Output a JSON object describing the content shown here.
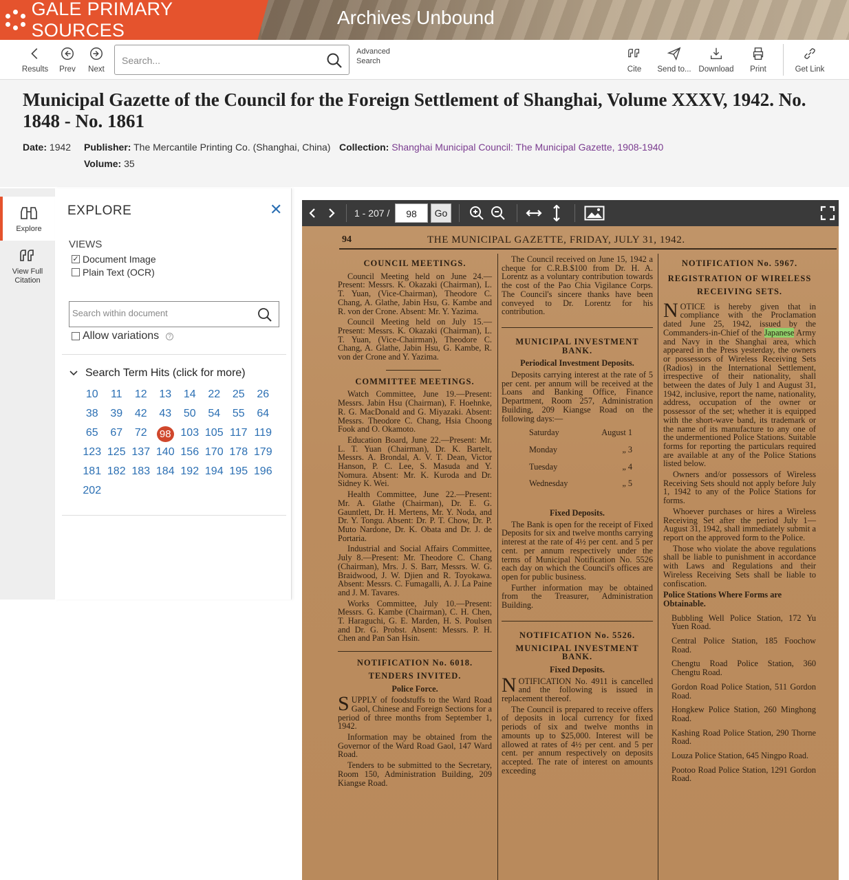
{
  "banner": {
    "brand": "GALE PRIMARY SOURCES",
    "product": "Archives Unbound"
  },
  "toolbar": {
    "results": "Results",
    "prev": "Prev",
    "next": "Next",
    "search_placeholder": "Search...",
    "advanced_search": "Advanced Search",
    "cite": "Cite",
    "send_to": "Send to...",
    "download": "Download",
    "print": "Print",
    "get_link": "Get Link"
  },
  "document": {
    "title": "Municipal Gazette of the Council for the Foreign Settlement of Shanghai, Volume XXXV, 1942. No. 1848 - No. 1861",
    "date_label": "Date:",
    "date": "1942",
    "publisher_label": "Publisher:",
    "publisher": "The Mercantile Printing Co. (Shanghai, China)",
    "collection_label": "Collection:",
    "collection": "Shanghai Municipal Council: The Municipal Gazette, 1908-1940",
    "volume_label": "Volume:",
    "volume": "35"
  },
  "rail": {
    "explore": "Explore",
    "view_full_citation": "View Full Citation"
  },
  "explore": {
    "title": "EXPLORE",
    "views_label": "VIEWS",
    "views": [
      {
        "label": "Document Image",
        "checked": true
      },
      {
        "label": "Plain Text (OCR)",
        "checked": false
      }
    ],
    "search_placeholder": "Search within document",
    "allow_variations": "Allow variations",
    "hits_header": "Search Term Hits (click for more)",
    "hits": [
      "10",
      "11",
      "12",
      "13",
      "14",
      "22",
      "25",
      "26",
      "38",
      "39",
      "42",
      "43",
      "50",
      "54",
      "55",
      "64",
      "65",
      "67",
      "72",
      "98",
      "103",
      "105",
      "117",
      "119",
      "123",
      "125",
      "137",
      "140",
      "156",
      "170",
      "178",
      "179",
      "181",
      "182",
      "183",
      "184",
      "192",
      "194",
      "195",
      "196",
      "202"
    ],
    "active_hit": "98"
  },
  "viewer": {
    "page_range": "1 - 207 /",
    "page_value": "98",
    "go": "Go"
  },
  "scan": {
    "page_number": "94",
    "running_head": "THE MUNICIPAL GAZETTE, FRIDAY, JULY 31, 1942.",
    "col1": {
      "h1": "COUNCIL MEETINGS.",
      "p1": "Council Meeting held on June 24.—Present: Messrs. K. Okazaki (Chairman), L. T. Yuan, (Vice-Chairman), Theodore C. Chang, A. Glathe, Jabin Hsu, G. Kambe and R. von der Crone. Absent: Mr. Y. Yazima.",
      "p2": "Council Meeting held on July 15.—Present: Messrs. K. Okazaki (Chairman), L. T. Yuan, (Vice-Chairman), Theodore C. Chang, A. Glathe, Jabin Hsu, G. Kambe, R. von der Crone and Y. Yazima.",
      "h2": "COMMITTEE MEETINGS.",
      "p3": "Watch Committee, June 19.—Present: Messrs. Jabin Hsu (Chairman), F. Hoehnke, R. G. MacDonald and G. Miyazaki. Absent: Messrs. Theodore C. Chang, Hsia Choong Fook and O. Okamoto.",
      "p4": "Education Board, June 22.—Present: Mr. L. T. Yuan (Chairman), Dr. K. Bartelt, Messrs. A. Brondal, A. V. T. Dean, Victor Hanson, P. C. Lee, S. Masuda and Y. Nomura. Absent: Mr. K. Kuroda and Dr. Sidney K. Wei.",
      "p5": "Health Committee, June 22.—Present: Mr. A. Glathe (Chairman), Dr. E. G. Gauntlett, Dr. H. Mertens, Mr. Y. Noda, and Dr. Y. Tongu. Absent: Dr. P. T. Chow, Dr. P. Muto Nardone, Dr. K. Obata and Dr. J. de Portaria.",
      "p6": "Industrial and Social Affairs Committee, July 8.—Present: Mr. Theodore C. Chang (Chairman), Mrs. J. S. Barr, Messrs. W. G. Braidwood, J. W. Djien and R. Toyokawa. Absent: Messrs. C. Fumagalli, A. J. La Paine and J. M. Tavares.",
      "p7": "Works Committee, July 10.—Present: Messrs. G. Kambe (Chairman), C. H. Chen, T. Haraguchi, G. E. Marden, H. S. Poulsen and Dr. G. Probst. Absent: Messrs. P. H. Chen and Pan San Hsin.",
      "h3": "NOTIFICATION No. 6018.",
      "h4": "TENDERS INVITED.",
      "sh1": "Police Force.",
      "p8": "UPPLY of foodstuffs to the Ward Road Gaol, Chinese and Foreign Sections for a period of three months from September 1, 1942.",
      "p9": "Information may be obtained from the Governor of the Ward Road Gaol, 147 Ward Road.",
      "p10": "Tenders to be submitted to the Secretary, Room 150, Administration Building, 209 Kiangse Road."
    },
    "col2": {
      "p1": "The Council received on June 15, 1942 a cheque for C.R.B.$100 from Dr. H. A. Lorentz as a voluntary contribution towards the cost of the Pao Chia Vigilance Corps. The Council's sincere thanks have been conveyed to Dr. Lorentz for his contribution.",
      "h1": "MUNICIPAL INVESTMENT BANK.",
      "sh1": "Periodical Investment Deposits.",
      "p2": "Deposits carrying interest at the rate of 5 per cent. per annum will be received at the Loans and Banking Office, Finance Department, Room 257, Administration Building, 209 Kiangse Road on the following days:—",
      "schedule": [
        {
          "day": "Saturday",
          "date": "August 1"
        },
        {
          "day": "Monday",
          "date": "„ 3"
        },
        {
          "day": "Tuesday",
          "date": "„ 4"
        },
        {
          "day": "Wednesday",
          "date": "„ 5"
        }
      ],
      "sh2": "Fixed Deposits.",
      "p3": "The Bank is open for the receipt of Fixed Deposits for six and twelve months carrying interest at the rate of 4½ per cent. and 5 per cent. per annum respectively under the terms of Municipal Notification No. 5526 each day on which the Council's offices are open for public business.",
      "p4": "Further information may be obtained from the Treasurer, Administration Building.",
      "h2": "NOTIFICATION No. 5526.",
      "h3": "MUNICIPAL INVESTMENT BANK.",
      "sh3": "Fixed Deposits.",
      "p5": "OTIFICATION No. 4911 is cancelled and the following is issued in replacement thereof.",
      "p6": "The Council is prepared to receive offers of deposits in local currency for fixed periods of six and twelve months in amounts up to $25,000. Interest will be allowed at rates of 4½ per cent. and 5 per cent. per annum respectively on deposits accepted. The rate of interest on amounts exceeding"
    },
    "col3": {
      "h1": "NOTIFICATION No. 5967.",
      "h2": "REGISTRATION OF WIRELESS RECEIVING SETS.",
      "p1a": "OTICE is hereby given that in compliance with the Proclamation dated June 25, 1942, issued by the Commanders-in-Chief of the",
      "p1hl": "Japanese",
      "p1b": "Army and Navy in the Shanghai area, which appeared in the Press yesterday, the owners or possessors of Wireless Receiving Sets (Radios) in the International Settlement, irrespective of their nationality, shall between the dates of July 1 and August 31, 1942, inclusive, report the name, nationality, address, occupation of the owner or possessor of the set; whether it is equipped with the short-wave band, its trademark or the name of its manufacture to any one of the undermentioned Police Stations. Suitable forms for reporting the particulars required are available at any of the Police Stations listed below.",
      "p2": "Owners and/or possessors of Wireless Receiving Sets should not apply before July 1, 1942 to any of the Police Stations for forms.",
      "p3": "Whoever purchases or hires a Wireless Receiving Set after the period July 1—August 31, 1942, shall immediately submit a report on the approved form to the Police.",
      "p4": "Those who violate the above regulations shall be liable to punishment in accordance with Laws and Regulations and their Wireless Receiving Sets shall be liable to confiscation.",
      "sh1": "Police Stations Where Forms are Obtainable.",
      "stations": [
        "Bubbling Well Police Station, 172 Yu Yuen Road.",
        "Central Police Station, 185 Foochow Road.",
        "Chengtu Road Police Station, 360 Chengtu Road.",
        "Gordon Road Police Station, 511 Gordon Road.",
        "Hongkew Police Station, 260 Minghong Road.",
        "Kashing Road Police Station, 290 Thorne Road.",
        "Louza Police Station, 645 Ningpo Road.",
        "Pootoo Road Police Station, 1291 Gordon Road."
      ]
    }
  },
  "colors": {
    "brand": "#e5532d",
    "link": "#2b6fb3",
    "collection_link": "#7a3b8f",
    "active_hit": "#d0472c"
  }
}
